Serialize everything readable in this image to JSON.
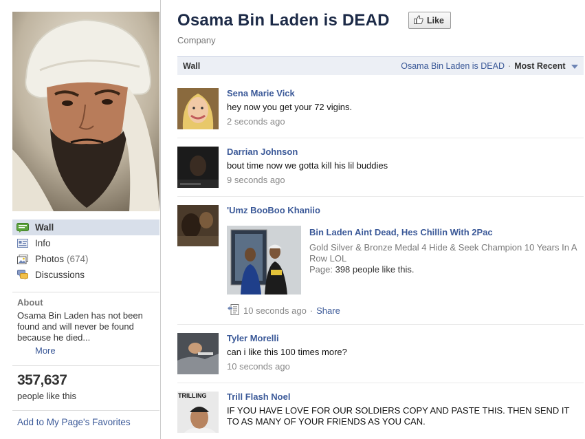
{
  "page": {
    "title": "Osama Bin Laden is DEAD",
    "category": "Company",
    "like_button": "Like"
  },
  "sidebar": {
    "nav": [
      {
        "label": "Wall",
        "icon": "wall-icon",
        "active": true
      },
      {
        "label": "Info",
        "icon": "info-icon"
      },
      {
        "label": "Photos",
        "count": "(674)",
        "icon": "photos-icon"
      },
      {
        "label": "Discussions",
        "icon": "discussions-icon"
      }
    ],
    "about": {
      "heading": "About",
      "text": "Osama Bin Laden has not been found and will never be found because he died...",
      "more": "More"
    },
    "likes": {
      "count": "357,637",
      "label": "people like this"
    },
    "favorites_link": "Add to My Page's Favorites"
  },
  "wall": {
    "title": "Wall",
    "filter_page": "Osama Bin Laden is DEAD",
    "separator": "·",
    "filter_sort": "Most Recent",
    "stories": [
      {
        "actor": "Sena Marie Vick",
        "message": "hey now you get your 72 vigins.",
        "time": "2 seconds ago"
      },
      {
        "actor": "Darrian Johnson",
        "message": "bout time now we gotta kill his lil buddies",
        "time": "9 seconds ago"
      },
      {
        "actor": "'Umz BooBoo Khaniio",
        "attachment": {
          "title": "Bin Laden Aint Dead, Hes Chillin With 2Pac",
          "description": "Gold Silver & Bronze Medal 4 Hide & Seek Champion 10 Years In A Row LOL",
          "fans_prefix": "Page: ",
          "fans": "398 people like this."
        },
        "time": "10 seconds ago",
        "separator": "·",
        "share": "Share"
      },
      {
        "actor": "Tyler Morelli",
        "message": "can i like this 100 times more?",
        "time": "10 seconds ago"
      },
      {
        "actor": "Trill Flash Noel",
        "message": "IF YOU HAVE LOVE FOR OUR SOLDIERS COPY AND PASTE THIS. THEN SEND IT TO AS MANY OF YOUR FRIENDS AS YOU CAN.",
        "avatar_text": "TRILLING"
      }
    ]
  },
  "colors": {
    "link": "#3b5998",
    "active_nav": "#d8dfea",
    "wall_bar": "#eceff5",
    "title": "#1c2a47"
  }
}
